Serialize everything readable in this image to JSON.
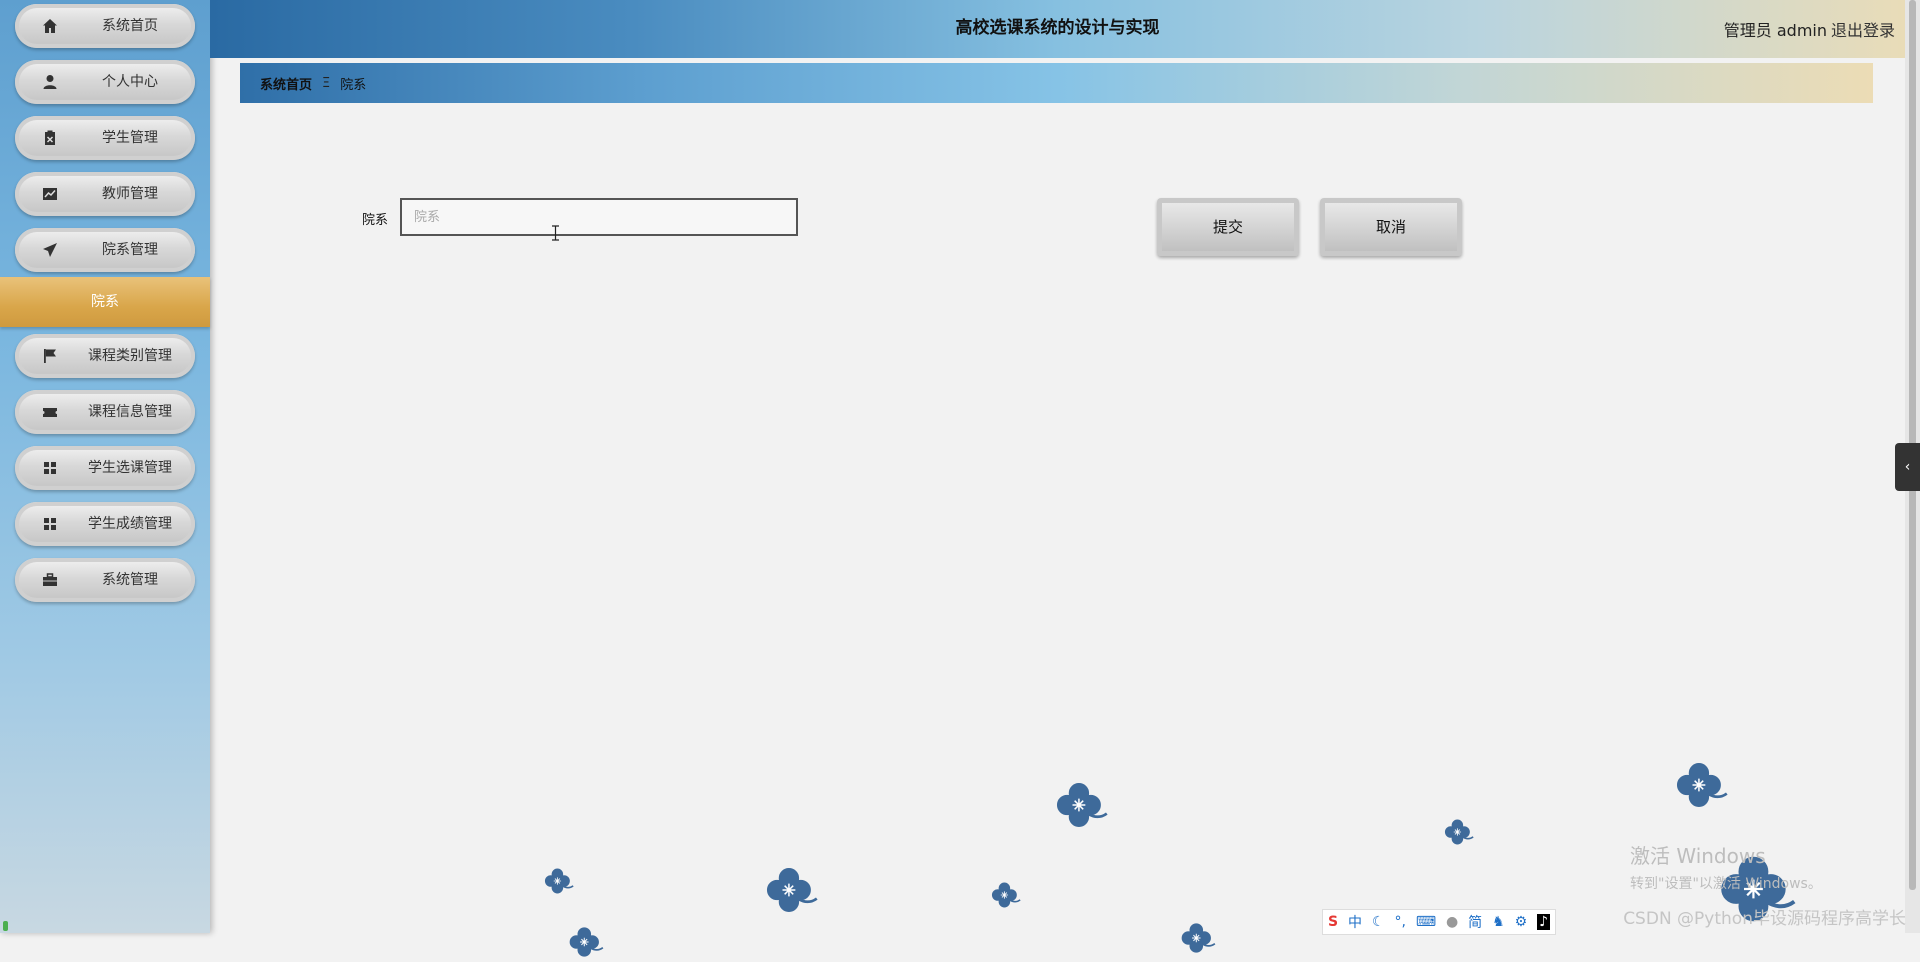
{
  "header": {
    "title": "高校选课系统的设计与实现",
    "user": "管理员 admin",
    "logout": "退出登录"
  },
  "sidebar": {
    "items": [
      {
        "label": "系统首页",
        "icon": "home-icon"
      },
      {
        "label": "个人中心",
        "icon": "user-icon"
      },
      {
        "label": "学生管理",
        "icon": "clipboard-icon"
      },
      {
        "label": "教师管理",
        "icon": "chart-icon"
      },
      {
        "label": "院系管理",
        "icon": "paper-plane-icon"
      },
      {
        "label": "课程类别管理",
        "icon": "flag-icon"
      },
      {
        "label": "课程信息管理",
        "icon": "ticket-icon"
      },
      {
        "label": "学生选课管理",
        "icon": "grid-icon"
      },
      {
        "label": "学生成绩管理",
        "icon": "grid-icon"
      },
      {
        "label": "系统管理",
        "icon": "briefcase-icon"
      }
    ],
    "submenu_label": "院系"
  },
  "breadcrumb": {
    "home": "系统首页",
    "separator": "Ξ",
    "current": "院系"
  },
  "form": {
    "label": "院系",
    "value": "",
    "placeholder": "院系",
    "submit": "提交",
    "cancel": "取消"
  },
  "overlay": {
    "win_activation_title": "激活 Windows",
    "win_activation_sub": "转到\"设置\"以激活 Windows。",
    "watermark": "CSDN @Python毕设源码程序高学长",
    "ime_items": [
      "中",
      "简"
    ]
  },
  "colors": {
    "accent_gold": "#d9a64a",
    "header_blue": "#2a6aa3",
    "flower": "#3e6a9a"
  }
}
